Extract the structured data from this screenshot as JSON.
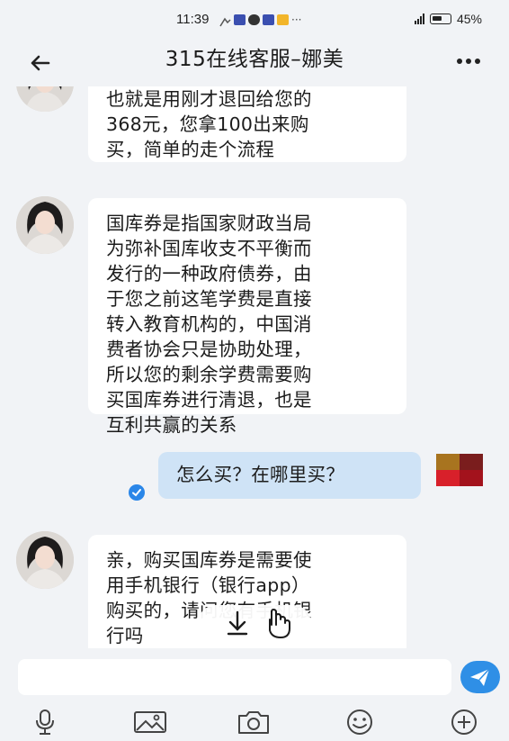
{
  "status_bar": {
    "time": "11:39",
    "dots": "···",
    "battery_pct": "45%"
  },
  "header": {
    "title": "315在线客服–娜美",
    "back_icon": "arrow-left-icon",
    "more_icon": "more-horizontal-icon"
  },
  "messages": [
    {
      "from": "agent",
      "lines": [
        "也就是用刚才退回给您的",
        "368元，您拿100出来购",
        "买，简单的走个流程"
      ]
    },
    {
      "from": "agent",
      "lines": [
        "国库券是指国家财政当局",
        "为弥补国库收支不平衡而",
        "发行的一种政府债券，由",
        "于您之前这笔学费是直接",
        "转入教育机构的，中国消",
        "费者协会只是协助处理，",
        "所以您的剩余学费需要购",
        "买国库券进行清退，也是",
        "互利共赢的关系"
      ]
    },
    {
      "from": "user",
      "lines": [
        "怎么买？在哪里买？"
      ]
    },
    {
      "from": "agent",
      "lines": [
        "亲，购买国库券是需要使",
        "用手机银行（银行app）",
        "购买的，请问您有手机银",
        "行吗"
      ]
    }
  ],
  "input": {
    "placeholder": ""
  },
  "toolbar": {
    "icons": [
      "microphone-icon",
      "image-icon",
      "camera-icon",
      "emoji-icon",
      "plus-icon"
    ]
  },
  "colors": {
    "background": "#f1f3f6",
    "agent_bubble": "#ffffff",
    "user_bubble": "#cfe3f6",
    "accent": "#2f8fe6"
  }
}
